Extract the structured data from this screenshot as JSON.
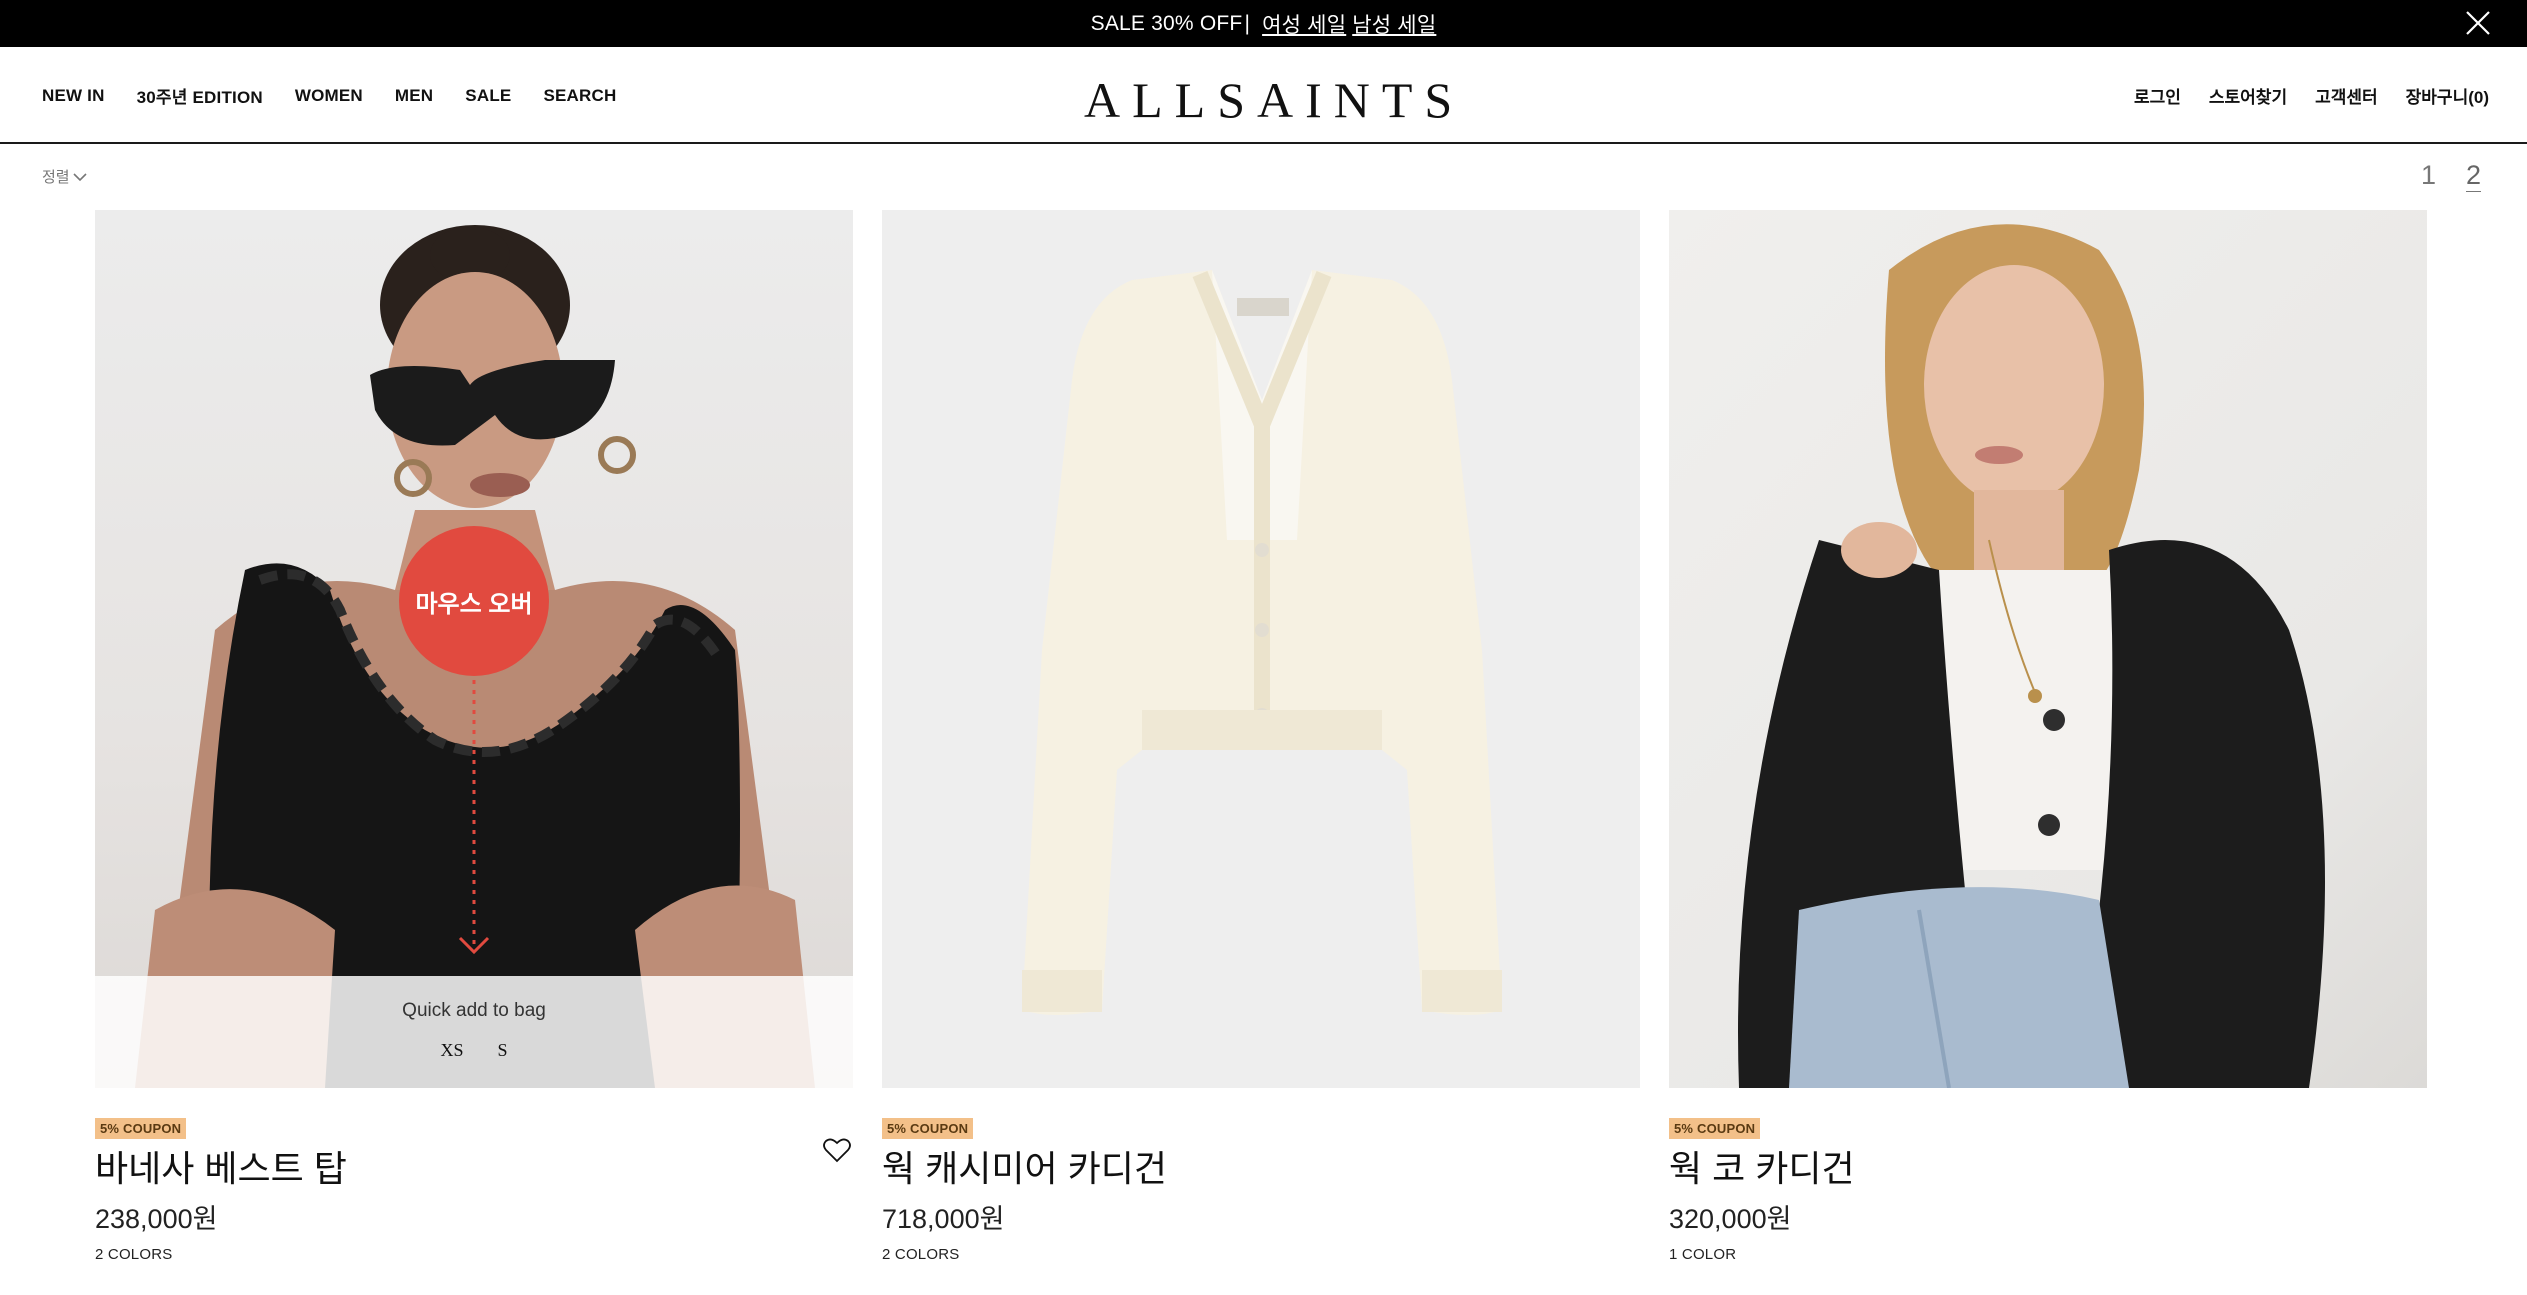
{
  "promo": {
    "text": "SALE 30% OFF",
    "separator": "|",
    "link_women": "여성 세일",
    "link_men": "남성 세일"
  },
  "header": {
    "logo": "ALLSAINTS",
    "nav_left": [
      "NEW IN",
      "30주년 EDITION",
      "WOMEN",
      "MEN",
      "SALE",
      "SEARCH"
    ],
    "nav_right": [
      "로그인",
      "스토어찾기",
      "고객센터",
      "장바구니(0)"
    ]
  },
  "sortbar": {
    "sort_label": "정렬",
    "pages": [
      "1",
      "2"
    ],
    "current_page": "2"
  },
  "products": [
    {
      "coupon": "5% COUPON",
      "name": "바네사 베스트 탑",
      "price": "238,000원",
      "colors": "2 COLORS",
      "quick_add": "Quick add to bag",
      "sizes": [
        "XS",
        "S"
      ],
      "hover_label": "마우스 오버"
    },
    {
      "coupon": "5% COUPON",
      "name": "웍 캐시미어 카디건",
      "price": "718,000원",
      "colors": "2 COLORS"
    },
    {
      "coupon": "5% COUPON",
      "name": "웍 코 카디건",
      "price": "320,000원",
      "colors": "1 COLOR"
    }
  ],
  "colors": {
    "promo_bg": "#000000",
    "coupon_bg": "#f3c089",
    "hover_badge": "#e14a3f"
  }
}
